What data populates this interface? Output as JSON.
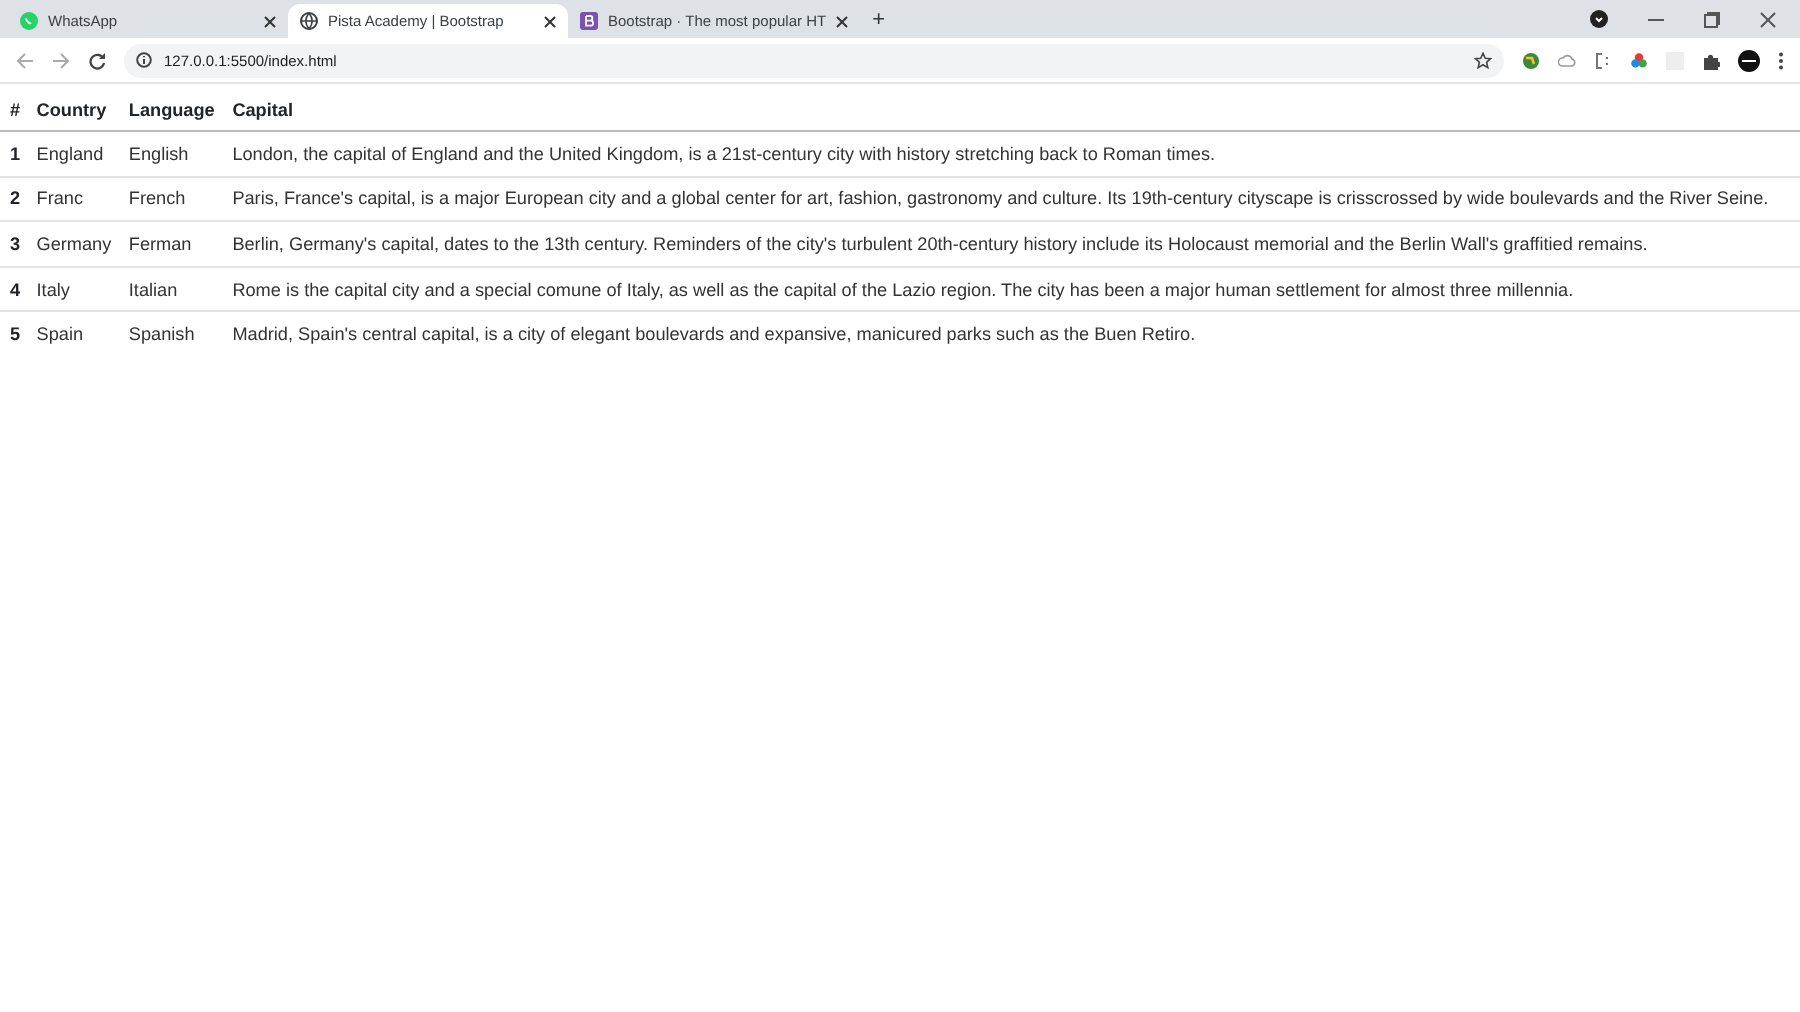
{
  "browser": {
    "tabs": [
      {
        "title": "WhatsApp",
        "selected": false
      },
      {
        "title": "Pista Academy | Bootstrap",
        "selected": true
      },
      {
        "title": "Bootstrap · The most popular HT",
        "selected": false
      }
    ],
    "new_tab": "+",
    "address": "127.0.0.1:5500/index.html"
  },
  "table": {
    "columns": [
      "#",
      "Country",
      "Language",
      "Capital"
    ],
    "rows": [
      [
        "1",
        "England",
        "English",
        "London, the capital of England and the United Kingdom, is a 21st-century city with history stretching back to Roman times."
      ],
      [
        "2",
        "Franc",
        "French",
        "Paris, France's capital, is a major European city and a global center for art, fashion, gastronomy and culture. Its 19th-century cityscape is crisscrossed by wide boulevards and the River Seine."
      ],
      [
        "3",
        "Germany",
        "Ferman",
        "Berlin, Germany's capital, dates to the 13th century. Reminders of the city's turbulent 20th-century history include its Holocaust memorial and the Berlin Wall's graffitied remains."
      ],
      [
        "4",
        "Italy",
        "Italian",
        "Rome is the capital city and a special comune of Italy, as well as the capital of the Lazio region. The city has been a major human settlement for almost three millennia."
      ],
      [
        "5",
        "Spain",
        "Spanish",
        "Madrid, Spain's central capital, is a city of elegant boulevards and expansive, manicured parks such as the Buen Retiro."
      ]
    ]
  }
}
